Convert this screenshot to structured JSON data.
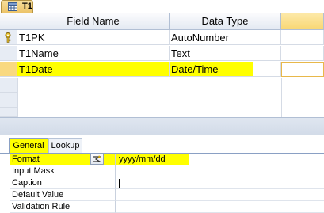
{
  "tab": {
    "label": "T1"
  },
  "grid": {
    "headers": {
      "field_name": "Field Name",
      "data_type": "Data Type",
      "description": ""
    },
    "rows": [
      {
        "name": "T1PK",
        "type": "AutoNumber",
        "primary_key": true,
        "highlighted": false
      },
      {
        "name": "T1Name",
        "type": "Text",
        "primary_key": false,
        "highlighted": false
      },
      {
        "name": "T1Date",
        "type": "Date/Time",
        "primary_key": false,
        "highlighted": true
      }
    ]
  },
  "properties": {
    "tabs": {
      "general": "General",
      "lookup": "Lookup"
    },
    "rows": [
      {
        "label": "Format",
        "value": "yyyy/mm/dd"
      },
      {
        "label": "Input Mask",
        "value": ""
      },
      {
        "label": "Caption",
        "value": ""
      },
      {
        "label": "Default Value",
        "value": ""
      },
      {
        "label": "Validation Rule",
        "value": ""
      }
    ]
  },
  "colors": {
    "highlight": "#ffff00",
    "active_header": "#f8d774"
  },
  "icons": {
    "tab_icon": "table-icon",
    "key": "primary-key-icon",
    "build": "build-button-icon"
  }
}
